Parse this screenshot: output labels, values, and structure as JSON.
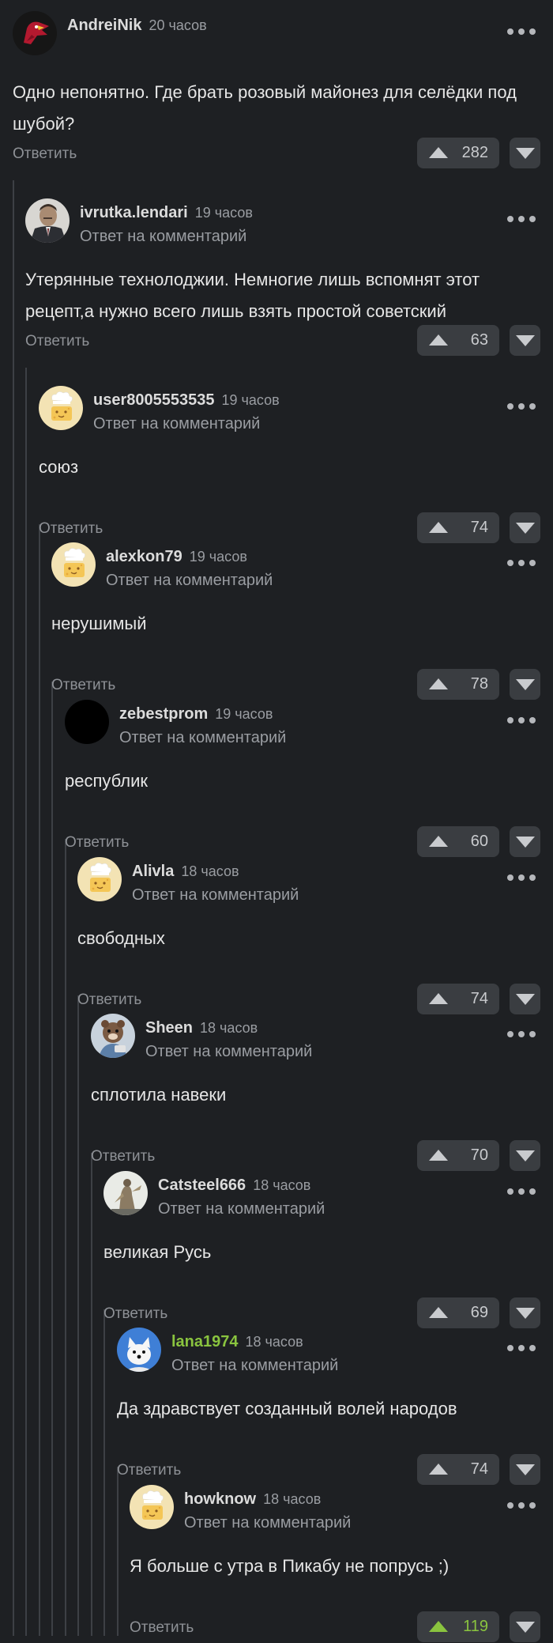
{
  "labels": {
    "reply": "Ответить",
    "reply_to": "Ответ на комментарий"
  },
  "comments": [
    {
      "author": "AndreiNik",
      "time": "20 часов",
      "text": "Одно непонятно. Где брать розовый майонез для селёдки под шубой?",
      "votes": "282",
      "avatar": "cardinals-logo"
    },
    {
      "author": "ivrutka.lendari",
      "time": "19 часов",
      "text": "Утерянные технолоджии. Немногие лишь вспомнят этот рецепт,а нужно всего лишь взять простой советский",
      "votes": "63",
      "avatar": "man-in-suit-photo"
    },
    {
      "author": "user8005553535",
      "time": "19 часов",
      "text": "союз",
      "votes": "74",
      "avatar": "default-cheese-avatar"
    },
    {
      "author": "alexkon79",
      "time": "19 часов",
      "text": "нерушимый",
      "votes": "78",
      "avatar": "default-cheese-avatar"
    },
    {
      "author": "zebestprom",
      "time": "19 часов",
      "text": "республик",
      "votes": "60",
      "avatar": "black-circle"
    },
    {
      "author": "Alivla",
      "time": "18 часов",
      "text": "свободных",
      "votes": "74",
      "avatar": "default-cheese-avatar"
    },
    {
      "author": "Sheen",
      "time": "18 часов",
      "text": "сплотила навеки",
      "votes": "70",
      "avatar": "cartoon-animal"
    },
    {
      "author": "Catsteel666",
      "time": "18 часов",
      "text": "великая Русь",
      "votes": "69",
      "avatar": "statue-photo"
    },
    {
      "author": "lana1974",
      "time": "18 часов",
      "text": "Да здравствует созданный волей народов",
      "votes": "74",
      "avatar": "white-dog",
      "author_color": "#8ac43f"
    },
    {
      "author": "howknow",
      "time": "18 часов",
      "text": "Я больше с утра в Пикабу не попрусь ;)",
      "votes": "119",
      "avatar": "default-cheese-avatar",
      "vote_active": true
    }
  ]
}
